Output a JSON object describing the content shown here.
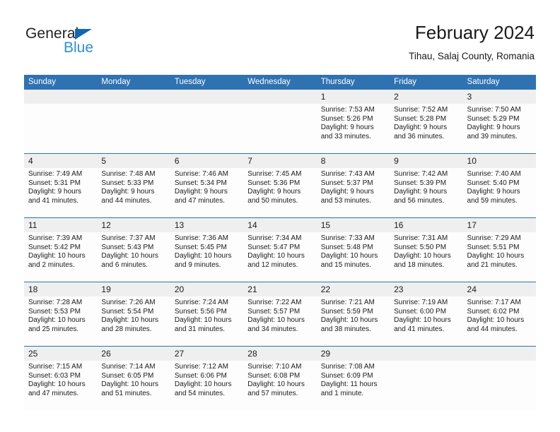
{
  "brand": {
    "name_part1": "General",
    "name_part2": "Blue",
    "triangle_icon": "brand-triangle-icon",
    "accent_dark": "#231f20",
    "accent_blue": "#1068b3",
    "accent_light_blue": "#2e8fd6"
  },
  "header": {
    "title": "February 2024",
    "subtitle": "Tihau, Salaj County, Romania"
  },
  "theme": {
    "header_blue": "#2f72b2",
    "daynum_band": "#efefef",
    "cell_bg": "#fdfdfd"
  },
  "weekdays": [
    "Sunday",
    "Monday",
    "Tuesday",
    "Wednesday",
    "Thursday",
    "Friday",
    "Saturday"
  ],
  "weeks": [
    [
      {
        "day": "",
        "sunrise": "",
        "sunset": "",
        "daylight1": "",
        "daylight2": ""
      },
      {
        "day": "",
        "sunrise": "",
        "sunset": "",
        "daylight1": "",
        "daylight2": ""
      },
      {
        "day": "",
        "sunrise": "",
        "sunset": "",
        "daylight1": "",
        "daylight2": ""
      },
      {
        "day": "",
        "sunrise": "",
        "sunset": "",
        "daylight1": "",
        "daylight2": ""
      },
      {
        "day": "1",
        "sunrise": "Sunrise: 7:53 AM",
        "sunset": "Sunset: 5:26 PM",
        "daylight1": "Daylight: 9 hours",
        "daylight2": "and 33 minutes."
      },
      {
        "day": "2",
        "sunrise": "Sunrise: 7:52 AM",
        "sunset": "Sunset: 5:28 PM",
        "daylight1": "Daylight: 9 hours",
        "daylight2": "and 36 minutes."
      },
      {
        "day": "3",
        "sunrise": "Sunrise: 7:50 AM",
        "sunset": "Sunset: 5:29 PM",
        "daylight1": "Daylight: 9 hours",
        "daylight2": "and 39 minutes."
      }
    ],
    [
      {
        "day": "4",
        "sunrise": "Sunrise: 7:49 AM",
        "sunset": "Sunset: 5:31 PM",
        "daylight1": "Daylight: 9 hours",
        "daylight2": "and 41 minutes."
      },
      {
        "day": "5",
        "sunrise": "Sunrise: 7:48 AM",
        "sunset": "Sunset: 5:33 PM",
        "daylight1": "Daylight: 9 hours",
        "daylight2": "and 44 minutes."
      },
      {
        "day": "6",
        "sunrise": "Sunrise: 7:46 AM",
        "sunset": "Sunset: 5:34 PM",
        "daylight1": "Daylight: 9 hours",
        "daylight2": "and 47 minutes."
      },
      {
        "day": "7",
        "sunrise": "Sunrise: 7:45 AM",
        "sunset": "Sunset: 5:36 PM",
        "daylight1": "Daylight: 9 hours",
        "daylight2": "and 50 minutes."
      },
      {
        "day": "8",
        "sunrise": "Sunrise: 7:43 AM",
        "sunset": "Sunset: 5:37 PM",
        "daylight1": "Daylight: 9 hours",
        "daylight2": "and 53 minutes."
      },
      {
        "day": "9",
        "sunrise": "Sunrise: 7:42 AM",
        "sunset": "Sunset: 5:39 PM",
        "daylight1": "Daylight: 9 hours",
        "daylight2": "and 56 minutes."
      },
      {
        "day": "10",
        "sunrise": "Sunrise: 7:40 AM",
        "sunset": "Sunset: 5:40 PM",
        "daylight1": "Daylight: 9 hours",
        "daylight2": "and 59 minutes."
      }
    ],
    [
      {
        "day": "11",
        "sunrise": "Sunrise: 7:39 AM",
        "sunset": "Sunset: 5:42 PM",
        "daylight1": "Daylight: 10 hours",
        "daylight2": "and 2 minutes."
      },
      {
        "day": "12",
        "sunrise": "Sunrise: 7:37 AM",
        "sunset": "Sunset: 5:43 PM",
        "daylight1": "Daylight: 10 hours",
        "daylight2": "and 6 minutes."
      },
      {
        "day": "13",
        "sunrise": "Sunrise: 7:36 AM",
        "sunset": "Sunset: 5:45 PM",
        "daylight1": "Daylight: 10 hours",
        "daylight2": "and 9 minutes."
      },
      {
        "day": "14",
        "sunrise": "Sunrise: 7:34 AM",
        "sunset": "Sunset: 5:47 PM",
        "daylight1": "Daylight: 10 hours",
        "daylight2": "and 12 minutes."
      },
      {
        "day": "15",
        "sunrise": "Sunrise: 7:33 AM",
        "sunset": "Sunset: 5:48 PM",
        "daylight1": "Daylight: 10 hours",
        "daylight2": "and 15 minutes."
      },
      {
        "day": "16",
        "sunrise": "Sunrise: 7:31 AM",
        "sunset": "Sunset: 5:50 PM",
        "daylight1": "Daylight: 10 hours",
        "daylight2": "and 18 minutes."
      },
      {
        "day": "17",
        "sunrise": "Sunrise: 7:29 AM",
        "sunset": "Sunset: 5:51 PM",
        "daylight1": "Daylight: 10 hours",
        "daylight2": "and 21 minutes."
      }
    ],
    [
      {
        "day": "18",
        "sunrise": "Sunrise: 7:28 AM",
        "sunset": "Sunset: 5:53 PM",
        "daylight1": "Daylight: 10 hours",
        "daylight2": "and 25 minutes."
      },
      {
        "day": "19",
        "sunrise": "Sunrise: 7:26 AM",
        "sunset": "Sunset: 5:54 PM",
        "daylight1": "Daylight: 10 hours",
        "daylight2": "and 28 minutes."
      },
      {
        "day": "20",
        "sunrise": "Sunrise: 7:24 AM",
        "sunset": "Sunset: 5:56 PM",
        "daylight1": "Daylight: 10 hours",
        "daylight2": "and 31 minutes."
      },
      {
        "day": "21",
        "sunrise": "Sunrise: 7:22 AM",
        "sunset": "Sunset: 5:57 PM",
        "daylight1": "Daylight: 10 hours",
        "daylight2": "and 34 minutes."
      },
      {
        "day": "22",
        "sunrise": "Sunrise: 7:21 AM",
        "sunset": "Sunset: 5:59 PM",
        "daylight1": "Daylight: 10 hours",
        "daylight2": "and 38 minutes."
      },
      {
        "day": "23",
        "sunrise": "Sunrise: 7:19 AM",
        "sunset": "Sunset: 6:00 PM",
        "daylight1": "Daylight: 10 hours",
        "daylight2": "and 41 minutes."
      },
      {
        "day": "24",
        "sunrise": "Sunrise: 7:17 AM",
        "sunset": "Sunset: 6:02 PM",
        "daylight1": "Daylight: 10 hours",
        "daylight2": "and 44 minutes."
      }
    ],
    [
      {
        "day": "25",
        "sunrise": "Sunrise: 7:15 AM",
        "sunset": "Sunset: 6:03 PM",
        "daylight1": "Daylight: 10 hours",
        "daylight2": "and 47 minutes."
      },
      {
        "day": "26",
        "sunrise": "Sunrise: 7:14 AM",
        "sunset": "Sunset: 6:05 PM",
        "daylight1": "Daylight: 10 hours",
        "daylight2": "and 51 minutes."
      },
      {
        "day": "27",
        "sunrise": "Sunrise: 7:12 AM",
        "sunset": "Sunset: 6:06 PM",
        "daylight1": "Daylight: 10 hours",
        "daylight2": "and 54 minutes."
      },
      {
        "day": "28",
        "sunrise": "Sunrise: 7:10 AM",
        "sunset": "Sunset: 6:08 PM",
        "daylight1": "Daylight: 10 hours",
        "daylight2": "and 57 minutes."
      },
      {
        "day": "29",
        "sunrise": "Sunrise: 7:08 AM",
        "sunset": "Sunset: 6:09 PM",
        "daylight1": "Daylight: 11 hours",
        "daylight2": "and 1 minute."
      },
      {
        "day": "",
        "sunrise": "",
        "sunset": "",
        "daylight1": "",
        "daylight2": ""
      },
      {
        "day": "",
        "sunrise": "",
        "sunset": "",
        "daylight1": "",
        "daylight2": ""
      }
    ]
  ]
}
